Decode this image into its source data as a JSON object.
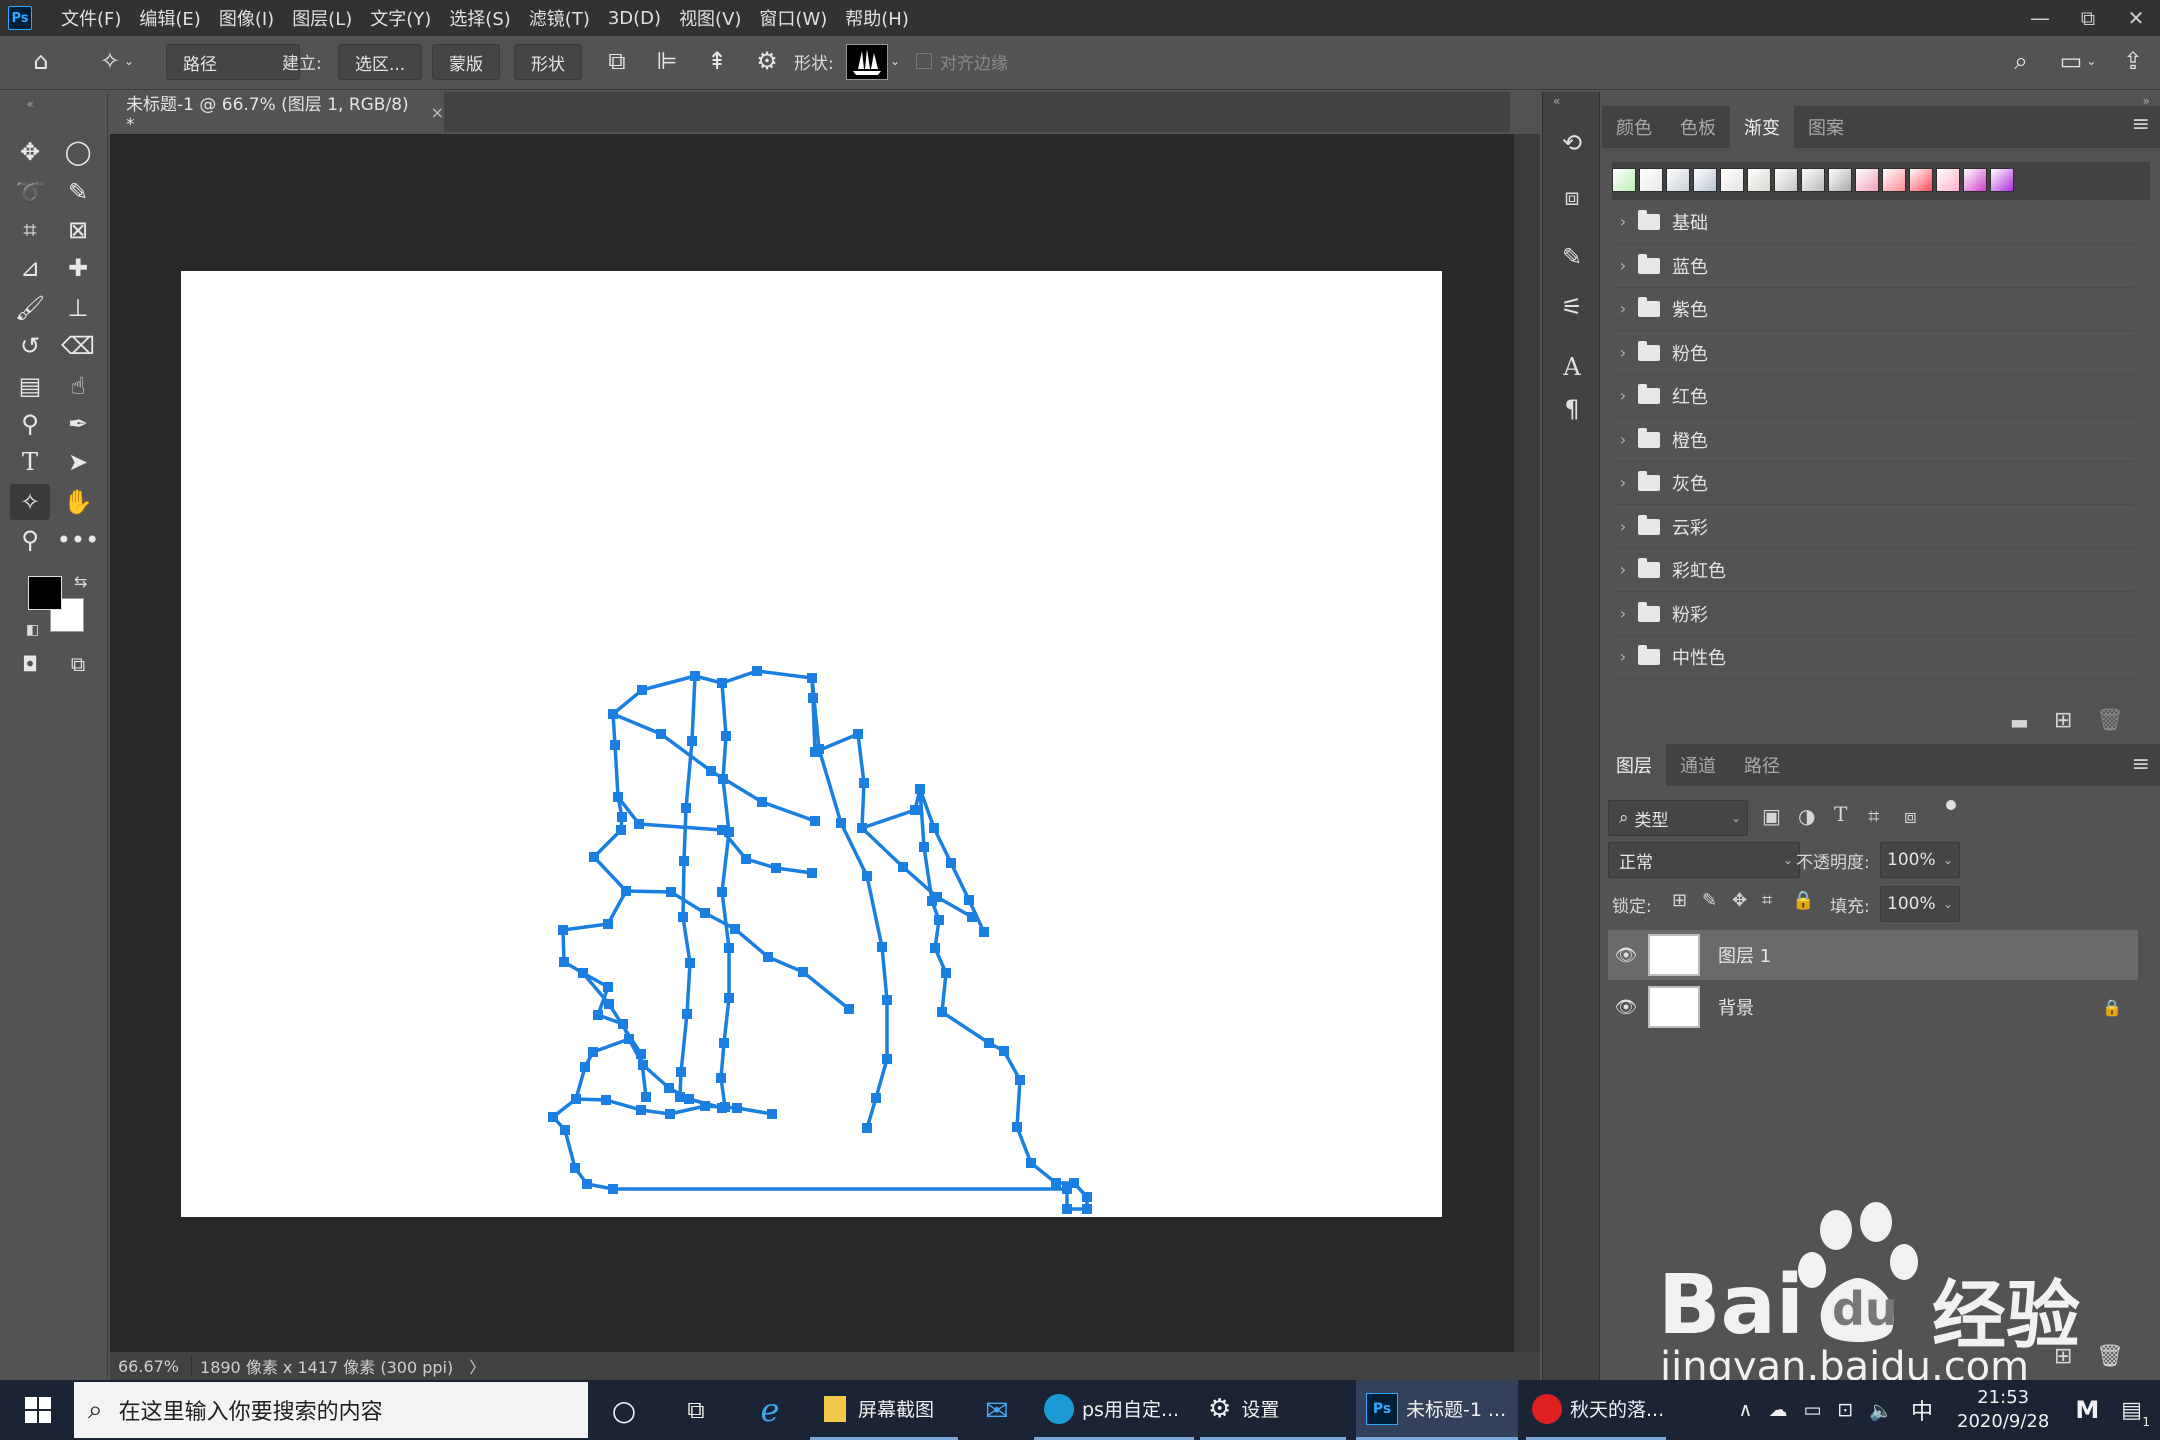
{
  "app": {
    "logo": "Ps"
  },
  "menu": [
    "文件(F)",
    "编辑(E)",
    "图像(I)",
    "图层(L)",
    "文字(Y)",
    "选择(S)",
    "滤镜(T)",
    "3D(D)",
    "视图(V)",
    "窗口(W)",
    "帮助(H)"
  ],
  "window_controls": {
    "minimize": "—",
    "restore": "⧉",
    "close": "✕"
  },
  "options": {
    "mode": "路径",
    "build_label": "建立:",
    "selection_btn": "选区...",
    "mask_btn": "蒙版",
    "shape_btn": "形状",
    "shape_label": "形状:",
    "align_edges": "对齐边缘"
  },
  "document": {
    "tab_title": "未标题-1 @ 66.7% (图层 1, RGB/8) *",
    "tab_close": "×",
    "zoom": "66.67%",
    "info": "1890 像素 x 1417 像素 (300 ppi)",
    "info_arrow": "〉"
  },
  "gradient_panel": {
    "tabs": [
      "颜色",
      "色板",
      "渐变",
      "图案"
    ],
    "active_tab": 2,
    "swatch_colors": [
      "#b8f0b0",
      "#e8e8e8",
      "#c8d0da",
      "#b8c4d2",
      "#e4e6e2",
      "#d8d8d0",
      "#c4c4c4",
      "#b8b8b8",
      "#a8a8a8",
      "#f0a0b8",
      "#ff8a94",
      "#ff4a5a",
      "#ffb0c8",
      "#d040c8",
      "#b030e0"
    ],
    "folders": [
      "基础",
      "蓝色",
      "紫色",
      "粉色",
      "红色",
      "橙色",
      "灰色",
      "云彩",
      "彩虹色",
      "粉彩",
      "中性色"
    ]
  },
  "layers_panel": {
    "tabs": [
      "图层",
      "通道",
      "路径"
    ],
    "active_tab": 0,
    "filter_label": "类型",
    "blend_mode": "正常",
    "opacity_label": "不透明度:",
    "opacity_value": "100%",
    "lock_label": "锁定:",
    "fill_label": "填充:",
    "fill_value": "100%",
    "layers": [
      {
        "name": "图层 1",
        "selected": true,
        "locked": false
      },
      {
        "name": "背景",
        "selected": false,
        "locked": true
      }
    ]
  },
  "taskbar": {
    "search_placeholder": "在这里输入你要搜索的内容",
    "items": [
      "屏幕截图",
      "ps用自定...",
      "设置",
      "未标题-1 ...",
      "秋天的落..."
    ],
    "ime": "中",
    "time": "21:53",
    "date": "2020/9/28",
    "notification_count": "1"
  },
  "watermark": {
    "brand": "Bai",
    "brand2": "du",
    "cn": "经验",
    "url": "jingyan.baidu.com"
  },
  "colors": {
    "path": "#1a7fe0",
    "accent": "#31a8ff"
  }
}
